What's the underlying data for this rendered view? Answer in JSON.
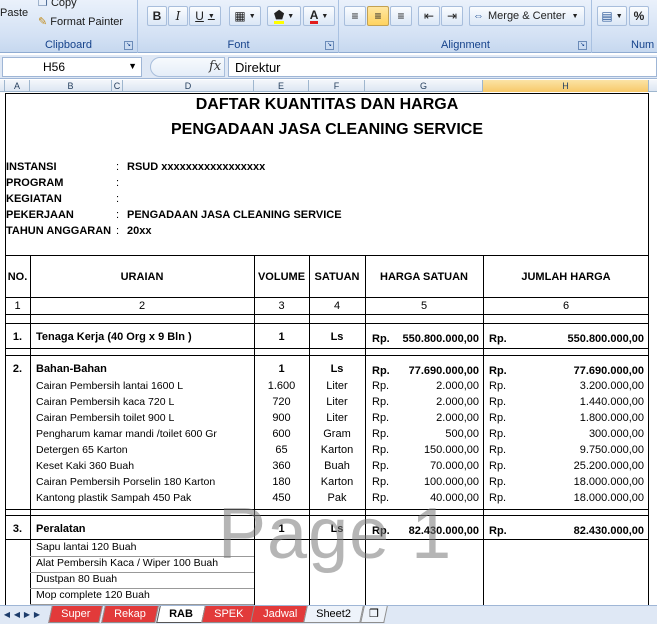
{
  "ribbon": {
    "paste_label": "Paste",
    "copy_label": "Copy",
    "format_painter_label": "Format Painter",
    "groups": {
      "clipboard": "Clipboard",
      "font": "Font",
      "alignment": "Alignment",
      "number": "Num"
    },
    "merge_center_label": "Merge & Center",
    "bold": "B",
    "italic": "I",
    "underline": "U",
    "percent": "%",
    "font_color_letter": "A"
  },
  "formula_bar": {
    "cell_ref": "H56",
    "fx": "fx",
    "value": "Direktur"
  },
  "columns": [
    "A",
    "B",
    "C",
    "D",
    "E",
    "F",
    "G",
    "H"
  ],
  "sheet": {
    "title_line1": "DAFTAR KUANTITAS DAN HARGA",
    "title_line2": "PENGADAAN JASA CLEANING SERVICE",
    "info": [
      {
        "label": "INSTANSI",
        "sep": ":",
        "value": "RSUD xxxxxxxxxxxxxxxxx"
      },
      {
        "label": "PROGRAM",
        "sep": ":",
        "value": ""
      },
      {
        "label": "KEGIATAN",
        "sep": ":",
        "value": ""
      },
      {
        "label": "PEKERJAAN",
        "sep": ":",
        "value": "PENGADAAN JASA CLEANING SERVICE"
      },
      {
        "label": "TAHUN ANGGARAN",
        "sep": ":",
        "value": "20xx"
      }
    ],
    "headers": {
      "no": "NO.",
      "uraian": "URAIAN",
      "volume": "VOLUME",
      "satuan": "SATUAN",
      "harga_satuan": "HARGA SATUAN",
      "jumlah_harga": "JUMLAH HARGA"
    },
    "header_numbers": [
      "1",
      "2",
      "3",
      "4",
      "5",
      "6"
    ],
    "currency": "Rp.",
    "sections": [
      {
        "no": "1.",
        "name": "Tenaga Kerja (40 Org x 9 Bln )",
        "volume": "1",
        "satuan": "Ls",
        "harga": "550.800.000,00",
        "jumlah": "550.800.000,00",
        "items": []
      },
      {
        "no": "2.",
        "name": "Bahan-Bahan",
        "volume": "1",
        "satuan": "Ls",
        "harga": "77.690.000,00",
        "jumlah": "77.690.000,00",
        "items": [
          {
            "name": "Cairan Pembersih lantai 1600 L",
            "volume": "1.600",
            "satuan": "Liter",
            "harga": "2.000,00",
            "jumlah": "3.200.000,00"
          },
          {
            "name": "Cairan Pembersih kaca 720 L",
            "volume": "720",
            "satuan": "Liter",
            "harga": "2.000,00",
            "jumlah": "1.440.000,00"
          },
          {
            "name": "Cairan Pembersih toilet 900 L",
            "volume": "900",
            "satuan": "Liter",
            "harga": "2.000,00",
            "jumlah": "1.800.000,00"
          },
          {
            "name": "Pengharum kamar mandi /toilet 600 Gr",
            "volume": "600",
            "satuan": "Gram",
            "harga": "500,00",
            "jumlah": "300.000,00"
          },
          {
            "name": "Detergen 65 Karton",
            "volume": "65",
            "satuan": "Karton",
            "harga": "150.000,00",
            "jumlah": "9.750.000,00"
          },
          {
            "name": "Keset Kaki 360 Buah",
            "volume": "360",
            "satuan": "Buah",
            "harga": "70.000,00",
            "jumlah": "25.200.000,00"
          },
          {
            "name": "Cairan Pembersih Porselin 180 Karton",
            "volume": "180",
            "satuan": "Karton",
            "harga": "100.000,00",
            "jumlah": "18.000.000,00"
          },
          {
            "name": "Kantong plastik Sampah 450 Pak",
            "volume": "450",
            "satuan": "Pak",
            "harga": "40.000,00",
            "jumlah": "18.000.000,00"
          }
        ]
      },
      {
        "no": "3.",
        "name": "Peralatan",
        "volume": "1",
        "satuan": "Ls",
        "harga": "82.430.000,00",
        "jumlah": "82.430.000,00",
        "items": [
          {
            "name": "Sapu lantai 120 Buah"
          },
          {
            "name": "Alat Pembersih Kaca / Wiper 100 Buah"
          },
          {
            "name": "Dustpan 80 Buah"
          },
          {
            "name": "Mop complete 120 Buah"
          }
        ]
      }
    ],
    "watermark": "Page 1"
  },
  "tabs": [
    {
      "label": "Super",
      "style": "red"
    },
    {
      "label": "Rekap",
      "style": "red"
    },
    {
      "label": "RAB",
      "style": "active"
    },
    {
      "label": "SPEK",
      "style": "red"
    },
    {
      "label": "Jadwal",
      "style": "red"
    },
    {
      "label": "Sheet2",
      "style": "plain"
    }
  ]
}
